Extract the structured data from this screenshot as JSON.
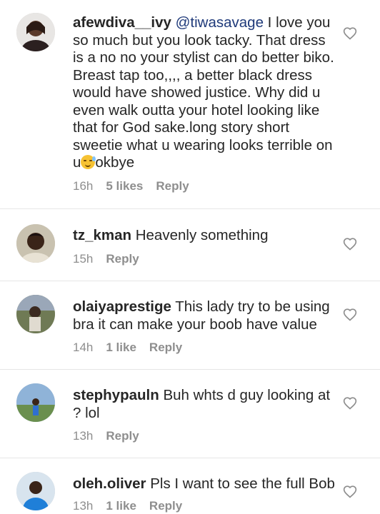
{
  "comments": [
    {
      "username": "afewdiva__ivy",
      "mention": "@tiwasavage",
      "text_before_emoji": " I love you so much but you look tacky. That dress is a no no your stylist can do better biko. Breast tap too,,,, a better black dress would have showed justice. Why did u even walk outta your hotel looking like that for God sake.long story short sweetie what u wearing looks terrible on u",
      "emoji": "sweat-smile-emoji",
      "text_after_emoji": "okbye",
      "time": "16h",
      "likes": "5 likes",
      "reply": "Reply"
    },
    {
      "username": "tz_kman",
      "text": " Heavenly something",
      "time": "15h",
      "reply": "Reply"
    },
    {
      "username": "olaiyaprestige",
      "text": " This lady try to be using bra it can make your boob have value",
      "time": "14h",
      "likes": "1 like",
      "reply": "Reply"
    },
    {
      "username": "stephypauln",
      "text": " Buh whts d guy looking at ? lol",
      "time": "13h",
      "reply": "Reply"
    },
    {
      "username": "oleh.oliver",
      "text": " Pls I want to see the full Bob",
      "time": "13h",
      "likes": "1 like",
      "reply": "Reply"
    }
  ],
  "icons": {
    "like": "heart-outline-icon"
  },
  "colors": {
    "mention": "#1f3a7a",
    "meta": "#8e8e8e",
    "divider": "#e6e6e6"
  }
}
